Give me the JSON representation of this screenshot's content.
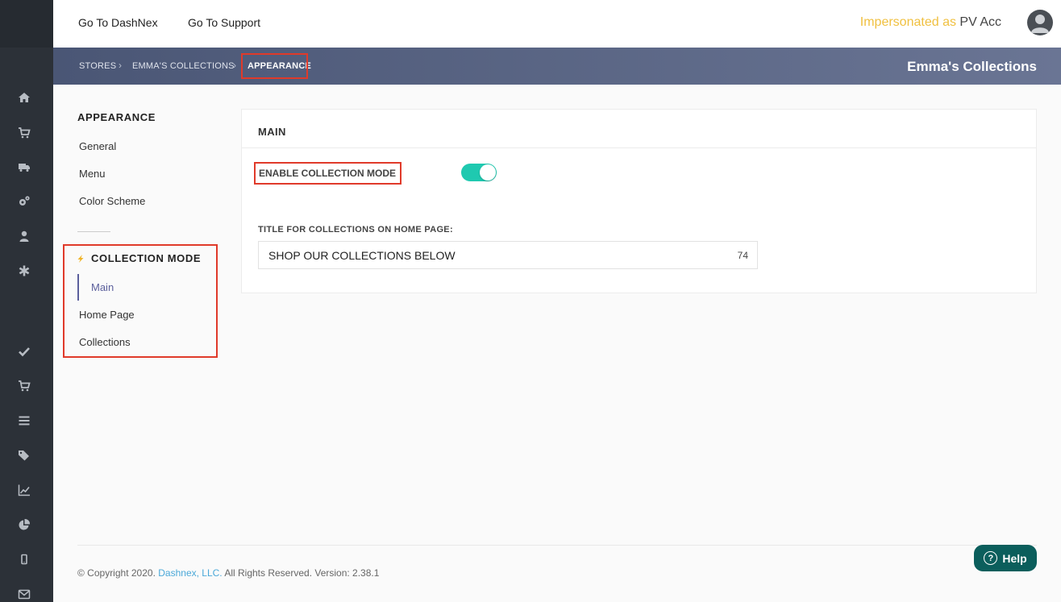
{
  "topbar": {
    "link_dashnex": "Go To DashNex",
    "link_support": "Go To Support",
    "impersonated_label": "Impersonated as",
    "impersonated_name": "PV Acc"
  },
  "breadcrumb": {
    "items": [
      "STORES",
      "EMMA'S COLLECTIONS",
      "APPEARANCE"
    ],
    "separator": "›",
    "store_title": "Emma's Collections"
  },
  "leftnav": {
    "heading": "APPEARANCE",
    "items": [
      "General",
      "Menu",
      "Color Scheme"
    ],
    "collection_mode_heading": "COLLECTION MODE",
    "collection_items": [
      "Main",
      "Home Page",
      "Collections"
    ]
  },
  "main": {
    "section_title": "MAIN",
    "enable_label": "ENABLE COLLECTION MODE",
    "enable_value": true,
    "title_label": "TITLE FOR COLLECTIONS ON HOME PAGE:",
    "title_value": "SHOP OUR COLLECTIONS BELOW",
    "title_count": "74"
  },
  "footer": {
    "prefix": "© Copyright 2020.",
    "company": "Dashnex, LLC.",
    "suffix": "All Rights Reserved. Version: 2.38.1"
  },
  "help": {
    "label": "Help"
  },
  "sidebar_icons": [
    "home-icon",
    "cart-icon",
    "truck-icon",
    "gears-icon",
    "user-icon",
    "asterisk-icon",
    "check-icon",
    "cart-icon",
    "list-icon",
    "tags-icon",
    "line-chart-icon",
    "pie-chart-icon",
    "mobile-icon",
    "envelope-icon"
  ],
  "colors": {
    "sidebar": "#2c3138",
    "accent_toggle": "#1fc9b0",
    "highlight_box": "#e03a2a",
    "active_nav": "#5b5f9c",
    "help_button": "#0b5e5c"
  }
}
